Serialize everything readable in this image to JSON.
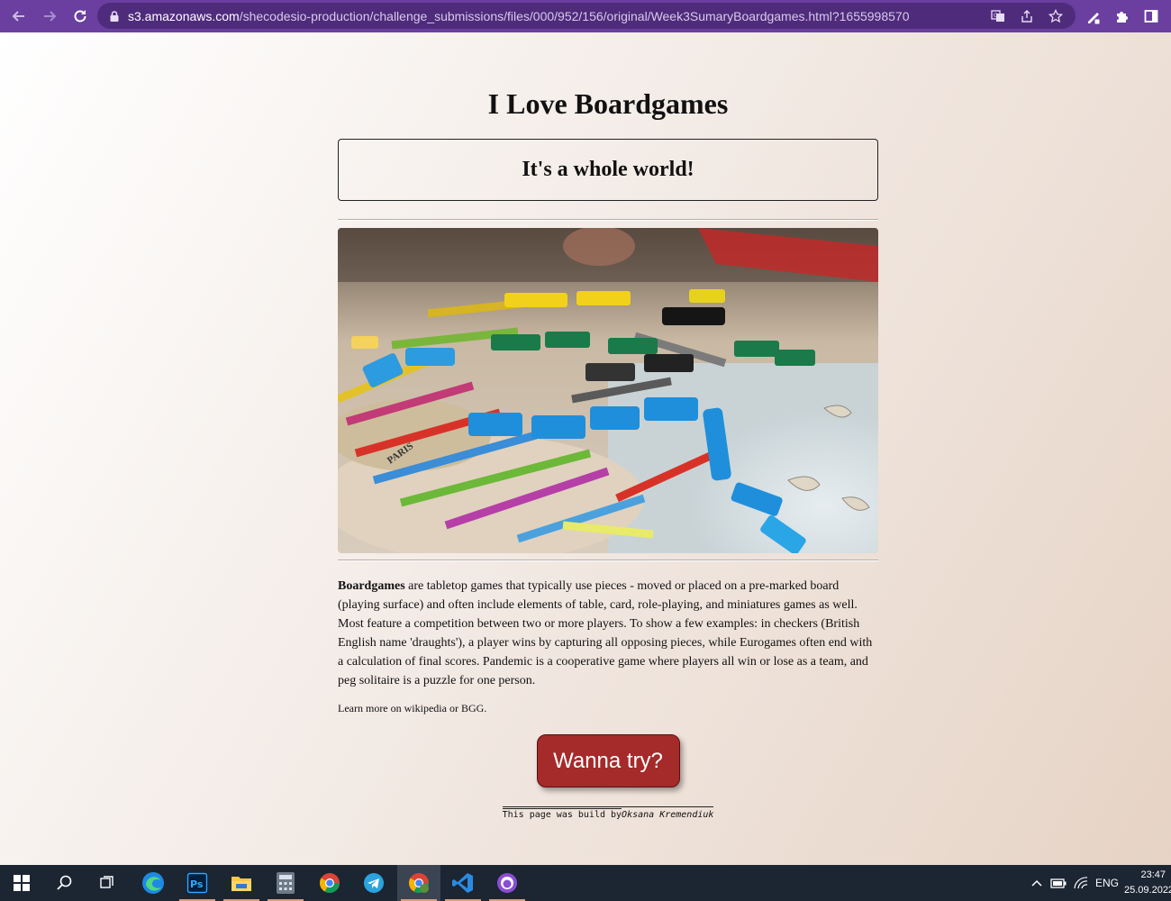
{
  "browser": {
    "url_host": "s3.amazonaws.com",
    "url_path": "/shecodesio-production/challenge_submissions/files/000/952/156/original/Week3SumaryBoardgames.html?1655998570",
    "icons": [
      "back-icon",
      "forward-icon",
      "reload-icon",
      "lock-icon",
      "translate-icon",
      "share-icon",
      "bookmark-star-icon",
      "pen-extension-icon",
      "puzzle-extensions-icon",
      "side-panel-icon"
    ]
  },
  "page": {
    "title": "I Love Boardgames",
    "subtitle": "It's a whole world!",
    "description_bold": "Boardgames",
    "description_rest": " are tabletop games that typically use pieces - moved or placed on a pre-marked board (playing surface) and often include elements of table, card, role-playing, and miniatures games as well. Most feature a competition between two or more players. To show a few examples: in checkers (British English name 'draughts'), a player wins by capturing all opposing pieces, while Eurogames often end with a calculation of final scores. Pandemic is a cooperative game where players all win or lose as a team, and peg solitaire is a puzzle for one person.",
    "learn_prefix": "Learn more on ",
    "learn_link1": "wikipedia",
    "learn_mid": " or ",
    "learn_link2": "BGG",
    "learn_suffix": ".",
    "cta_label": "Wanna try?",
    "footer_prefix": "This page was build by ",
    "footer_author": "Oksana Kremendiuk",
    "hero_labels": [
      "PARIS"
    ]
  },
  "taskbar": {
    "apps": [
      "windows-start",
      "search",
      "task-view",
      "edge",
      "photoshop",
      "file-explorer",
      "calculator",
      "chrome",
      "telegram",
      "chrome-profile",
      "vscode",
      "github-desktop"
    ],
    "lang": "ENG",
    "time": "23:47",
    "date": "25.09.2022"
  },
  "colors": {
    "chrome_bg": "#6a3fa0",
    "button_bg": "#a52a2a",
    "taskbar_bg": "#1c2532"
  }
}
